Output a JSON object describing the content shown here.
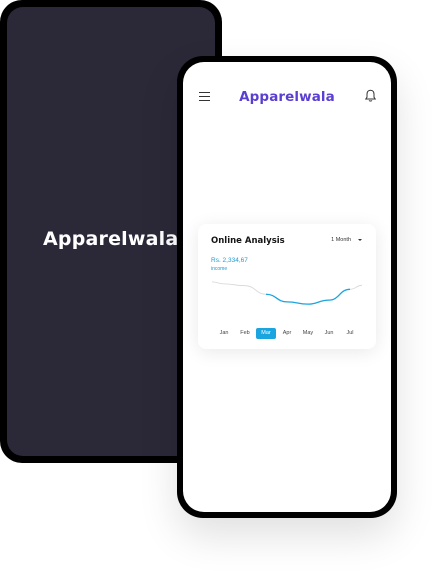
{
  "splash": {
    "brand": "Apparelwala"
  },
  "app": {
    "brand": "Apparelwala",
    "icons": {
      "menu": "hamburger-menu-icon",
      "notifications": "bell-icon"
    },
    "brand_color": "#5b3fd1"
  },
  "card": {
    "title": "Online Analysis",
    "period": "1 Month",
    "amount": "Rs. 2,334,67",
    "amount_label": "income",
    "accent_color": "#1aa5e0"
  },
  "chart_data": {
    "type": "line",
    "categories": [
      "Jan",
      "Feb",
      "Mar",
      "Apr",
      "May",
      "Jun",
      "Jul"
    ],
    "selected": "Mar",
    "values": [
      0.78,
      0.74,
      0.55,
      0.38,
      0.33,
      0.42,
      0.66
    ],
    "highlight_range": [
      "Mar",
      "Jul"
    ],
    "grid": false,
    "title": "Online Analysis",
    "xlabel": "",
    "ylabel": ""
  }
}
